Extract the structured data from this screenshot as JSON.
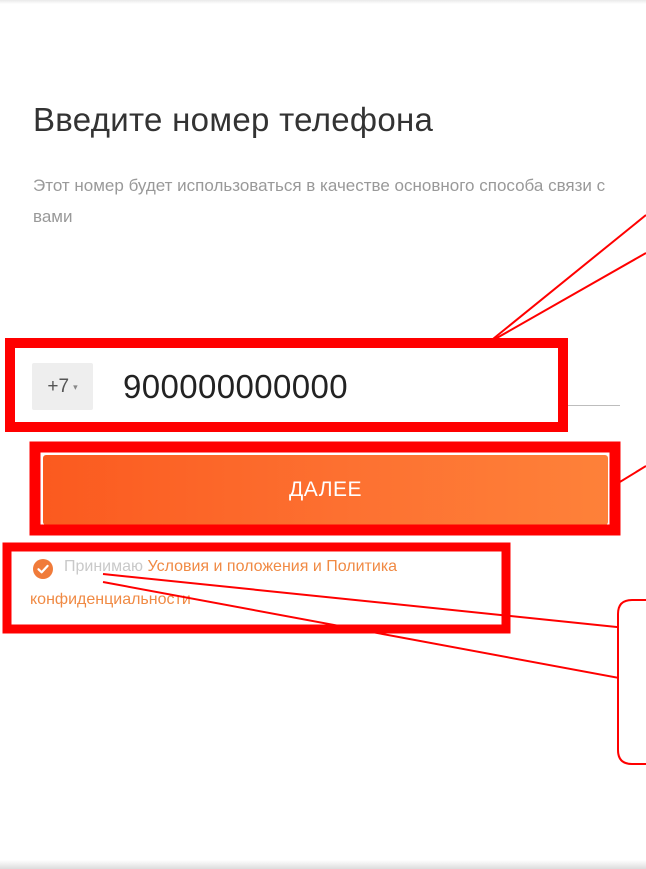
{
  "header": {
    "title": "Введите номер телефона",
    "subtitle": "Этот номер будет использоваться в качестве основного способа связи с вами"
  },
  "phone": {
    "country_code": "+7",
    "country_chevron": "▾",
    "value": "900000000000"
  },
  "actions": {
    "next_label": "ДАЛЕЕ"
  },
  "consent": {
    "checked": true,
    "prefix": "Принимаю",
    "terms_link": "Условия и положения",
    "conjunction": "и",
    "privacy_link": "Политика конфиденциальности"
  },
  "colors": {
    "accent": "#fd6a2b",
    "annotation": "#ff0000",
    "link": "#f08a44"
  },
  "icons": {
    "consent_check": "check-circle-icon",
    "country_chevron": "chevron-down-icon"
  }
}
